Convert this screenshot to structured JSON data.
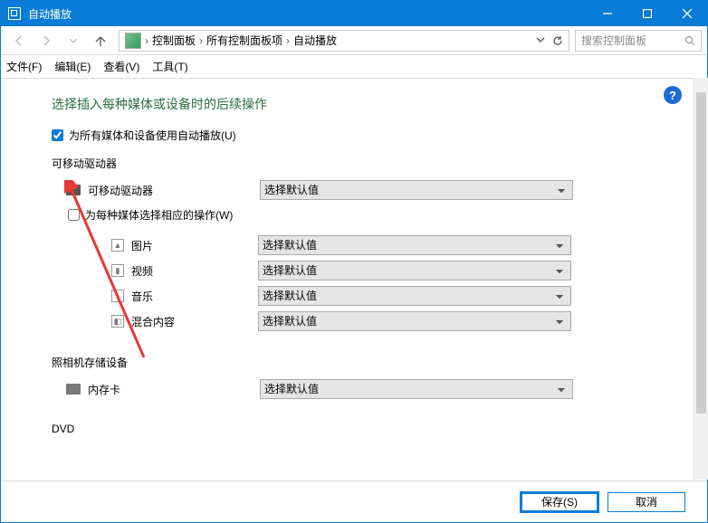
{
  "window": {
    "title": "自动播放"
  },
  "breadcrumb": {
    "seg1": "控制面板",
    "seg2": "所有控制面板项",
    "seg3": "自动播放"
  },
  "search": {
    "placeholder": "搜索控制面板"
  },
  "menu": {
    "file": "文件(F)",
    "edit": "编辑(E)",
    "view": "查看(V)",
    "tools": "工具(T)"
  },
  "page": {
    "heading": "选择插入每种媒体或设备时的后续操作",
    "help_symbol": "?",
    "checkbox_all": {
      "label": "为所有媒体和设备使用自动播放(U)",
      "checked": true
    },
    "section_removable": "可移动驱动器",
    "device_removable": "可移动驱动器",
    "combo_default": "选择默认值",
    "checkbox_each": {
      "label": "为每种媒体选择相应的操作(W)",
      "checked": false
    },
    "media": {
      "pictures": "图片",
      "videos": "视频",
      "music": "音乐",
      "mixed": "混合内容"
    },
    "section_camera": "照相机存储设备",
    "device_memcard": "内存卡",
    "section_dvd": "DVD"
  },
  "footer": {
    "save": "保存(S)",
    "cancel": "取消"
  }
}
